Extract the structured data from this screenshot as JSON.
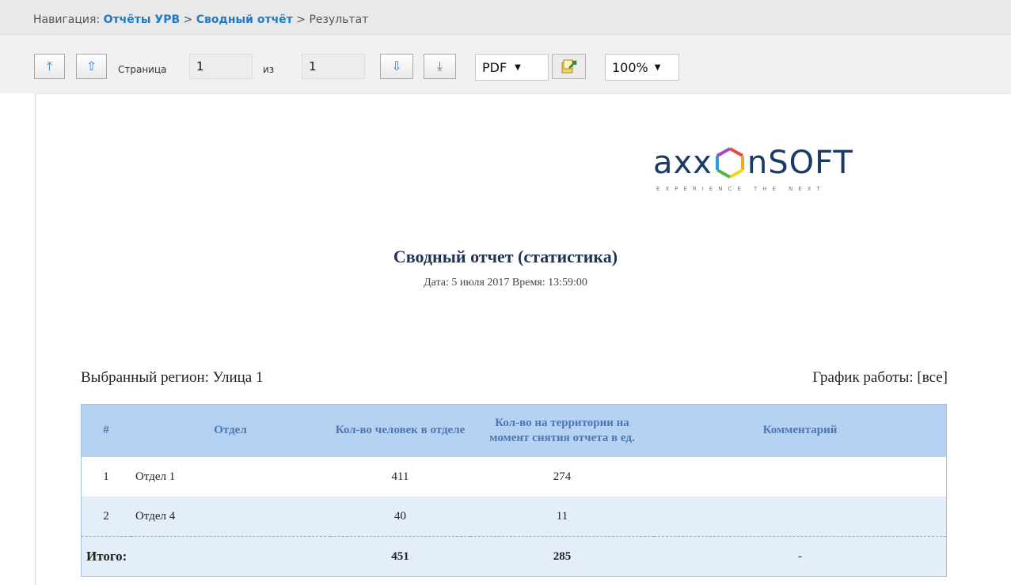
{
  "nav": {
    "prefix": "Навигация:",
    "crumb1": "Отчёты УРВ",
    "sep1": " > ",
    "crumb2": "Сводный отчёт",
    "sep2": " > ",
    "current": "Результат"
  },
  "toolbar": {
    "first_page_icon": "arrow-up-to-top-icon",
    "prev_page_icon": "arrow-up-icon",
    "page_label": "Страница",
    "page_value": "1",
    "of_label": "из",
    "total_pages": "1",
    "next_page_icon": "arrow-down-icon",
    "last_page_icon": "arrow-down-to-bottom-icon",
    "format_value": "PDF",
    "export_icon": "export-icon",
    "zoom_value": "100%"
  },
  "report": {
    "logo_text_left": "axx",
    "logo_text_right": "nSOFT",
    "logo_tagline": "EXPERIENCE THE NEXT",
    "title": "Сводный отчет (статистика)",
    "date_line": "Дата: 5 июля 2017 Время: 13:59:00",
    "region": "Выбранный регион: Улица 1",
    "schedule": "График работы: [все]",
    "table": {
      "headers": [
        "#",
        "Отдел",
        "Кол-во человек в отделе",
        "Кол-во на территории на момент снятия отчета в ед.",
        "Комментарий"
      ],
      "rows": [
        {
          "num": "1",
          "dept": "Отдел 1",
          "people": "411",
          "territory": "274",
          "comment": ""
        },
        {
          "num": "2",
          "dept": "Отдел 4",
          "people": "40",
          "territory": "11",
          "comment": ""
        }
      ],
      "total": {
        "label": "Итого:",
        "people": "451",
        "territory": "285",
        "comment": "-"
      }
    }
  },
  "colors": {
    "link": "#1e7bc8",
    "header_bg": "#b5d2f2",
    "header_text": "#4d76b5",
    "title": "#1f3357"
  }
}
